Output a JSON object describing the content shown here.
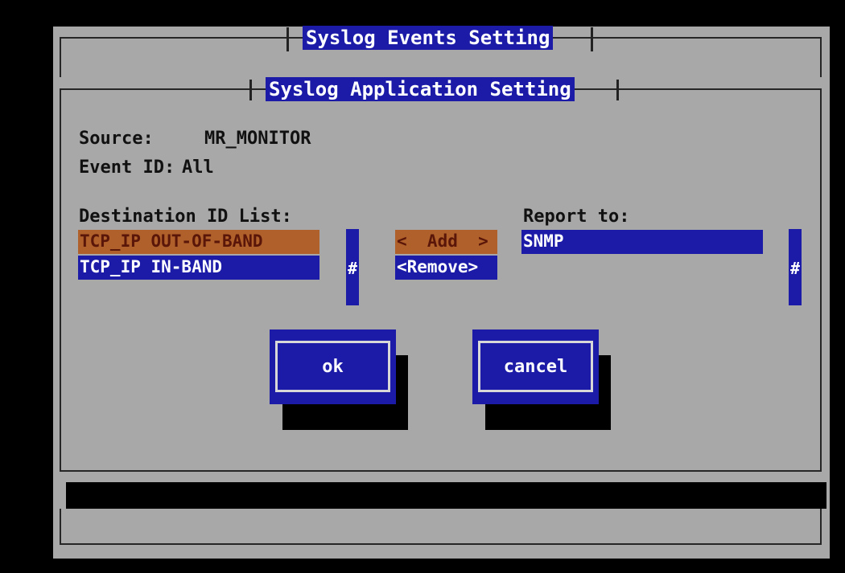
{
  "window": {
    "outer_title": "Syslog Events Setting",
    "inner_title": "Syslog Application Setting"
  },
  "info": {
    "source_label": "Source:",
    "source_value": "MR_MONITOR",
    "event_label": "Event ID:",
    "event_value": "All"
  },
  "destination": {
    "label": "Destination ID List:",
    "items": [
      "TCP_IP OUT-OF-BAND",
      "TCP_IP IN-BAND"
    ],
    "scroll_glyph": "#"
  },
  "actions": {
    "add_label": "<  Add  >",
    "remove_label": "<Remove>"
  },
  "report": {
    "label": "Report to:",
    "items": [
      "SNMP"
    ],
    "scroll_glyph": "#"
  },
  "buttons": {
    "ok_label": "ok",
    "cancel_label": "cancel"
  },
  "colors": {
    "panel": "#a8a8a8",
    "highlight_blue": "#1b1ba8",
    "selection_orange": "#b0602a",
    "text": "#111111"
  }
}
